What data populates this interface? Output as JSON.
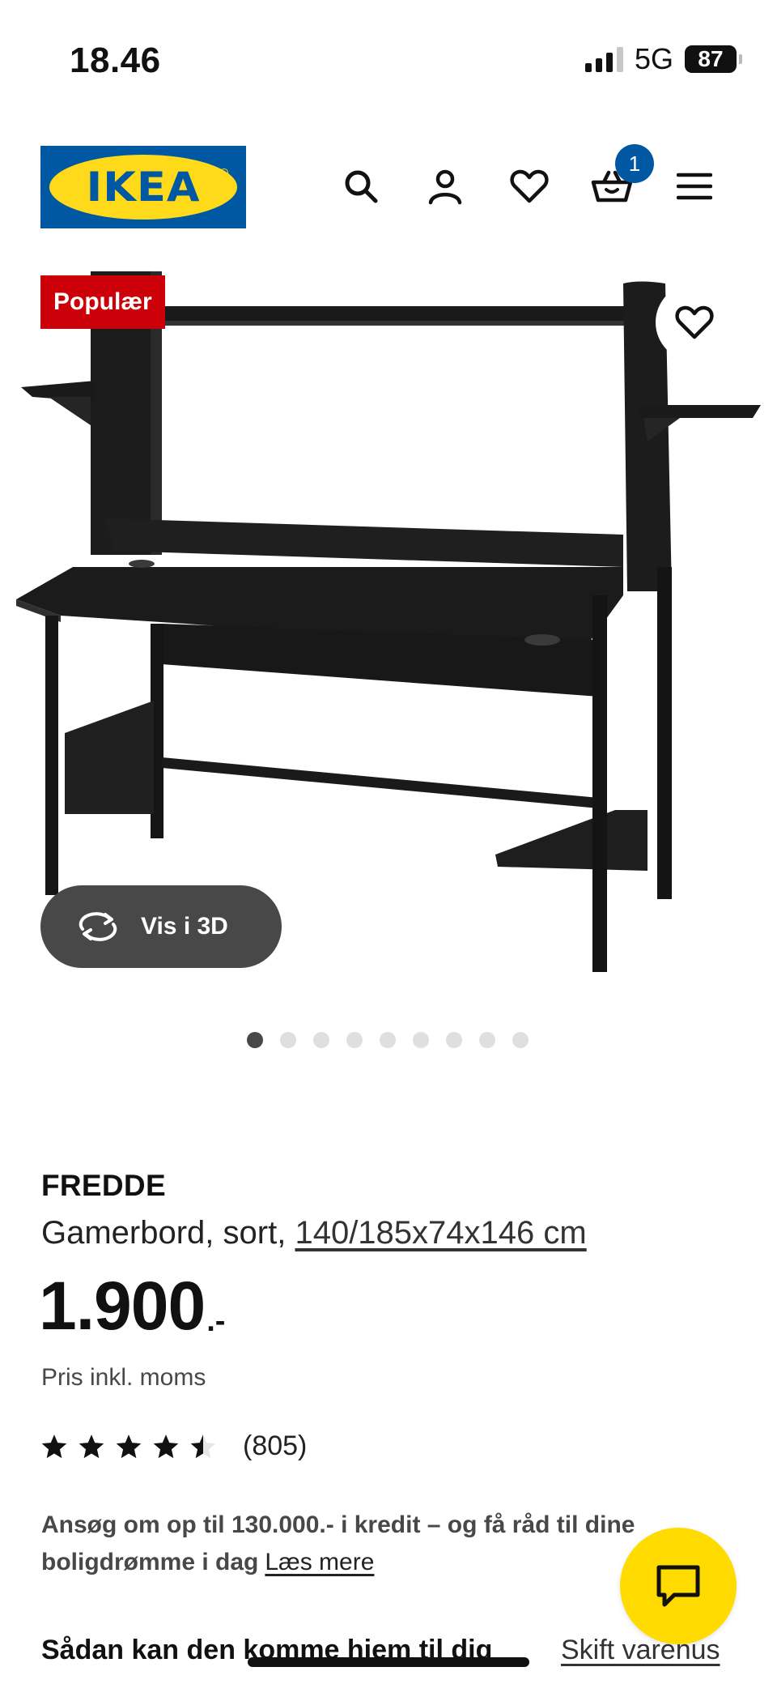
{
  "status_bar": {
    "time": "18.46",
    "network": "5G",
    "battery": "87"
  },
  "header": {
    "logo_text": "IKEA",
    "icons": [
      "search-icon",
      "account-icon",
      "heart-icon",
      "basket-icon",
      "menu-icon"
    ],
    "cart_count": "1",
    "brand_blue": "#0058a3",
    "brand_yellow": "#ffda1a"
  },
  "gallery": {
    "badge": "Populær",
    "badge_color": "#cc0008",
    "view_3d_label": "Vis i 3D",
    "dot_count": 9,
    "active_dot": 1
  },
  "product": {
    "name": "FREDDE",
    "description": "Gamerbord, sort,",
    "dimensions": "140/185x74x146 cm",
    "price": "1.900",
    "price_suffix": ".-",
    "price_note": "Pris inkl. moms",
    "rating_value": 4.5,
    "rating_max": 5,
    "review_count": "(805)"
  },
  "credit": {
    "text": "Ansøg om op til 130.000.- i kredit – og få råd til dine boligdrømme i dag",
    "link": "Læs mere"
  },
  "delivery": {
    "title": "Sådan kan den komme hjem til dig",
    "change_store": "Skift varehus"
  },
  "chat": {
    "icon": "chat-icon",
    "color": "#ffdb00"
  }
}
